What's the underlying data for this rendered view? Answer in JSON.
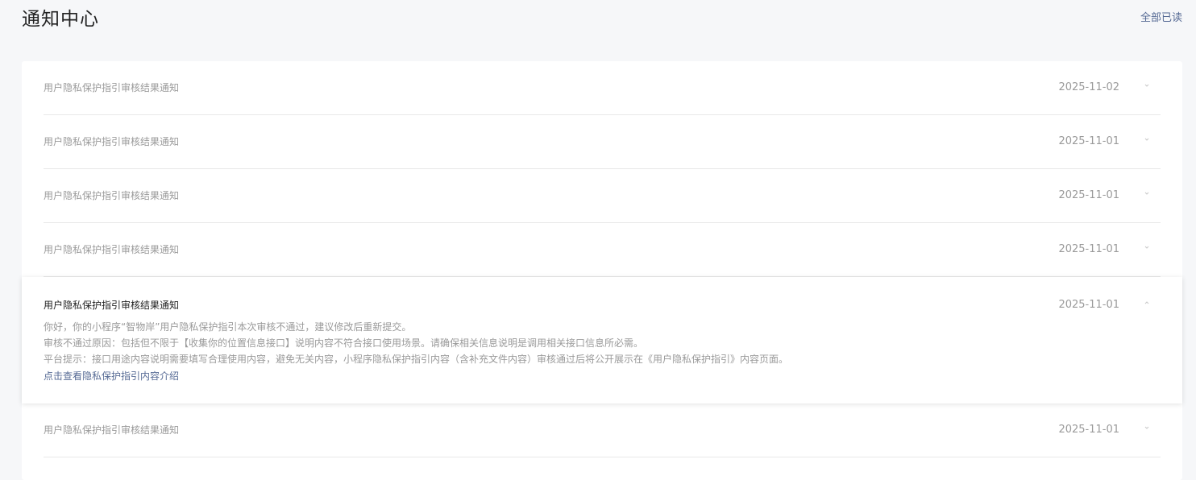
{
  "header": {
    "title": "通知中心",
    "mark_all_read": "全部已读"
  },
  "notifications": [
    {
      "title": "用户隐私保护指引审核结果通知",
      "date": "2025-11-02"
    },
    {
      "title": "用户隐私保护指引审核结果通知",
      "date": "2025-11-01"
    },
    {
      "title": "用户隐私保护指引审核结果通知",
      "date": "2025-11-01"
    },
    {
      "title": "用户隐私保护指引审核结果通知",
      "date": "2025-11-01"
    },
    {
      "title": "用户隐私保护指引审核结果通知",
      "date": "2025-11-01",
      "expanded": true,
      "body": [
        "你好，你的小程序“智物岸”用户隐私保护指引本次审核不通过，建议修改后重新提交。",
        "审核不通过原因：包括但不限于【收集你的位置信息接口】说明内容不符合接口使用场景。请确保相关信息说明是调用相关接口信息所必需。",
        "平台提示：接口用途内容说明需要填写合理使用内容，避免无关内容，小程序隐私保护指引内容（含补充文件内容）审核通过后将公开展示在《用户隐私保护指引》内容页面。"
      ],
      "link": "点击查看隐私保护指引内容介绍"
    },
    {
      "title": "用户隐私保护指引审核结果通知",
      "date": "2025-11-01"
    }
  ]
}
